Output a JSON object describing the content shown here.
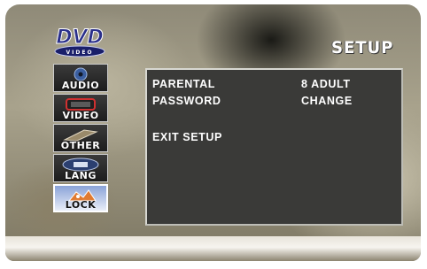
{
  "logo": {
    "brand": "DVD",
    "sub": "VIDEO"
  },
  "title": "SETUP",
  "tabs": [
    {
      "label": "AUDIO",
      "icon": "audio-icon"
    },
    {
      "label": "VIDEO",
      "icon": "video-icon"
    },
    {
      "label": "OTHER",
      "icon": "other-icon"
    },
    {
      "label": "LANG",
      "icon": "lang-icon"
    },
    {
      "label": "LOCK",
      "icon": "lock-icon",
      "active": true
    }
  ],
  "menu": {
    "items": [
      {
        "label": "PARENTAL",
        "value": "8 ADULT"
      },
      {
        "label": "PASSWORD",
        "value": "CHANGE"
      }
    ],
    "exit_label": "EXIT SETUP"
  },
  "colors": {
    "panel": "#3a3a38",
    "panel_border": "#d8d8d2",
    "active_tab": "#8aa3d8"
  }
}
